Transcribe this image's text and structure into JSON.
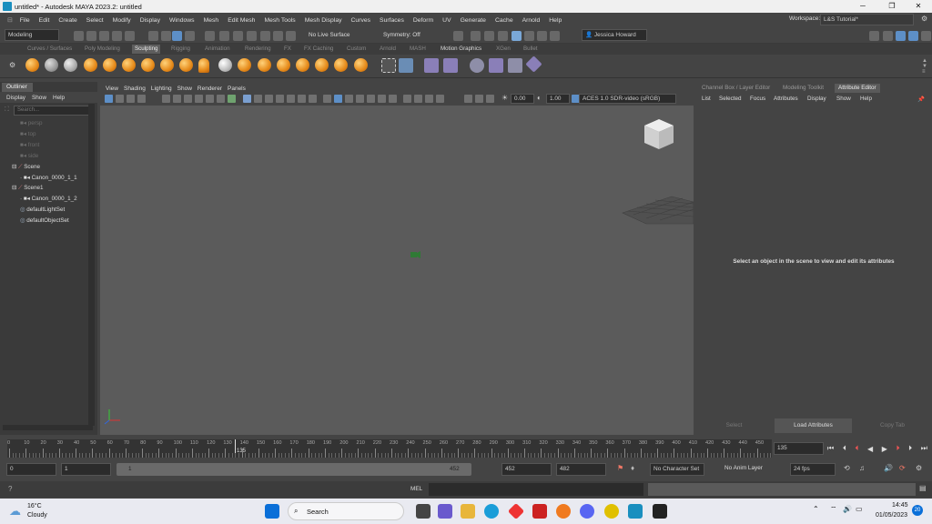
{
  "window": {
    "title": "untitled* - Autodesk MAYA 2023.2: untitled",
    "min": "─",
    "max": "❐",
    "close": "✕"
  },
  "menu": [
    "File",
    "Edit",
    "Create",
    "Select",
    "Modify",
    "Display",
    "Windows",
    "Mesh",
    "Edit Mesh",
    "Mesh Tools",
    "Mesh Display",
    "Curves",
    "Surfaces",
    "Deform",
    "UV",
    "Generate",
    "Cache",
    "Arnold",
    "Help"
  ],
  "workspace": {
    "label": "Workspace:",
    "value": "L&S Tutorial*"
  },
  "toolbar": {
    "mode": "Modeling",
    "live_surface": "No Live Surface",
    "symmetry": "Symmetry: Off",
    "user": "Jessica Howard"
  },
  "shelf_tabs": [
    "Curves / Surfaces",
    "Poly Modeling",
    "Sculpting",
    "Rigging",
    "Animation",
    "Rendering",
    "FX",
    "FX Caching",
    "Custom",
    "Arnold",
    "MASH",
    "Motion Graphics",
    "XGen",
    "Bullet"
  ],
  "shelf_active": "Sculpting",
  "outliner": {
    "tab": "Outliner",
    "menu": [
      "Display",
      "Show",
      "Help"
    ],
    "search_placeholder": "Search...",
    "items": [
      {
        "label": "persp",
        "dim": true
      },
      {
        "label": "top",
        "dim": true
      },
      {
        "label": "front",
        "dim": true
      },
      {
        "label": "side",
        "dim": true
      },
      {
        "label": "Scene",
        "dim": false
      },
      {
        "label": "Canon_0000_1_1",
        "dim": false
      },
      {
        "label": "Scene1",
        "dim": false
      },
      {
        "label": "Canon_0000_1_2",
        "dim": false
      },
      {
        "label": "defaultLightSet",
        "dim": false
      },
      {
        "label": "defaultObjectSet",
        "dim": false
      }
    ]
  },
  "viewport": {
    "menu": [
      "View",
      "Shading",
      "Lighting",
      "Show",
      "Renderer",
      "Panels"
    ],
    "exposure": "0.00",
    "gamma": "1.00",
    "colorspace": "ACES 1.0 SDR-video (sRGB)"
  },
  "right_panel": {
    "tabs": [
      "Channel Box / Layer Editor",
      "Modeling Toolkit",
      "Attribute Editor"
    ],
    "active": "Attribute Editor",
    "menu": [
      "List",
      "Selected",
      "Focus",
      "Attributes",
      "Display",
      "Show",
      "Help"
    ],
    "message": "Select an object in the scene to view and edit its attributes",
    "buttons": [
      "Select",
      "Load Attributes",
      "Copy Tab"
    ]
  },
  "timeline": {
    "ticks": [
      "0",
      "10",
      "20",
      "30",
      "40",
      "50",
      "60",
      "70",
      "80",
      "90",
      "100",
      "110",
      "120",
      "130",
      "140",
      "150",
      "160",
      "170",
      "180",
      "190",
      "200",
      "210",
      "220",
      "230",
      "240",
      "250",
      "260",
      "270",
      "280",
      "290",
      "300",
      "310",
      "320",
      "330",
      "340",
      "350",
      "360",
      "370",
      "380",
      "390",
      "400",
      "410",
      "420",
      "430",
      "440",
      "450"
    ],
    "current": "135",
    "current_field": "135"
  },
  "range": {
    "start": "0",
    "play_start": "1",
    "slider_start": "1",
    "slider_end": "452",
    "play_end": "452",
    "end": "482",
    "character_set": "No Character Set",
    "anim_layer": "No Anim Layer",
    "fps": "24 fps"
  },
  "command": {
    "lang": "MEL"
  },
  "taskbar": {
    "temp": "16°C",
    "weather": "Cloudy",
    "search": "Search",
    "time": "14:45",
    "date": "01/05/2023",
    "notif": "20"
  }
}
